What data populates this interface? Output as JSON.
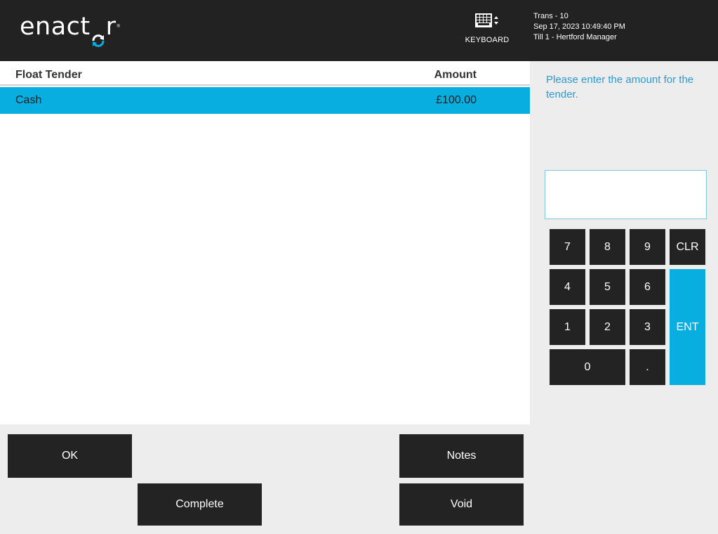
{
  "header": {
    "logo_text_before": "enact",
    "logo_text_after": "r",
    "logo_reg": "®",
    "keyboard_label": "KEYBOARD",
    "trans": "Trans - 10",
    "datetime": "Sep 17, 2023 10:49:40 PM",
    "till": "Till 1 - Hertford Manager"
  },
  "table": {
    "columns": {
      "tender": "Float Tender",
      "amount": "Amount"
    },
    "rows": [
      {
        "tender": "Cash",
        "amount": "£100.00"
      }
    ]
  },
  "prompt": "Please enter the amount for the tender.",
  "entry_value": "",
  "keypad": {
    "k7": "7",
    "k8": "8",
    "k9": "9",
    "clr": "CLR",
    "k4": "4",
    "k5": "5",
    "k6": "6",
    "k1": "1",
    "k2": "2",
    "k3": "3",
    "ent": "ENT",
    "k0": "0",
    "dot": "."
  },
  "buttons": {
    "ok": "OK",
    "notes": "Notes",
    "complete": "Complete",
    "void": "Void"
  },
  "colors": {
    "header_bg": "#222222",
    "accent": "#08aee0",
    "button_bg": "#232323",
    "prompt_text": "#2a9bd2"
  },
  "icons": {
    "keyboard": "keyboard-icon",
    "logo_mark": "refresh-arrows-icon"
  }
}
